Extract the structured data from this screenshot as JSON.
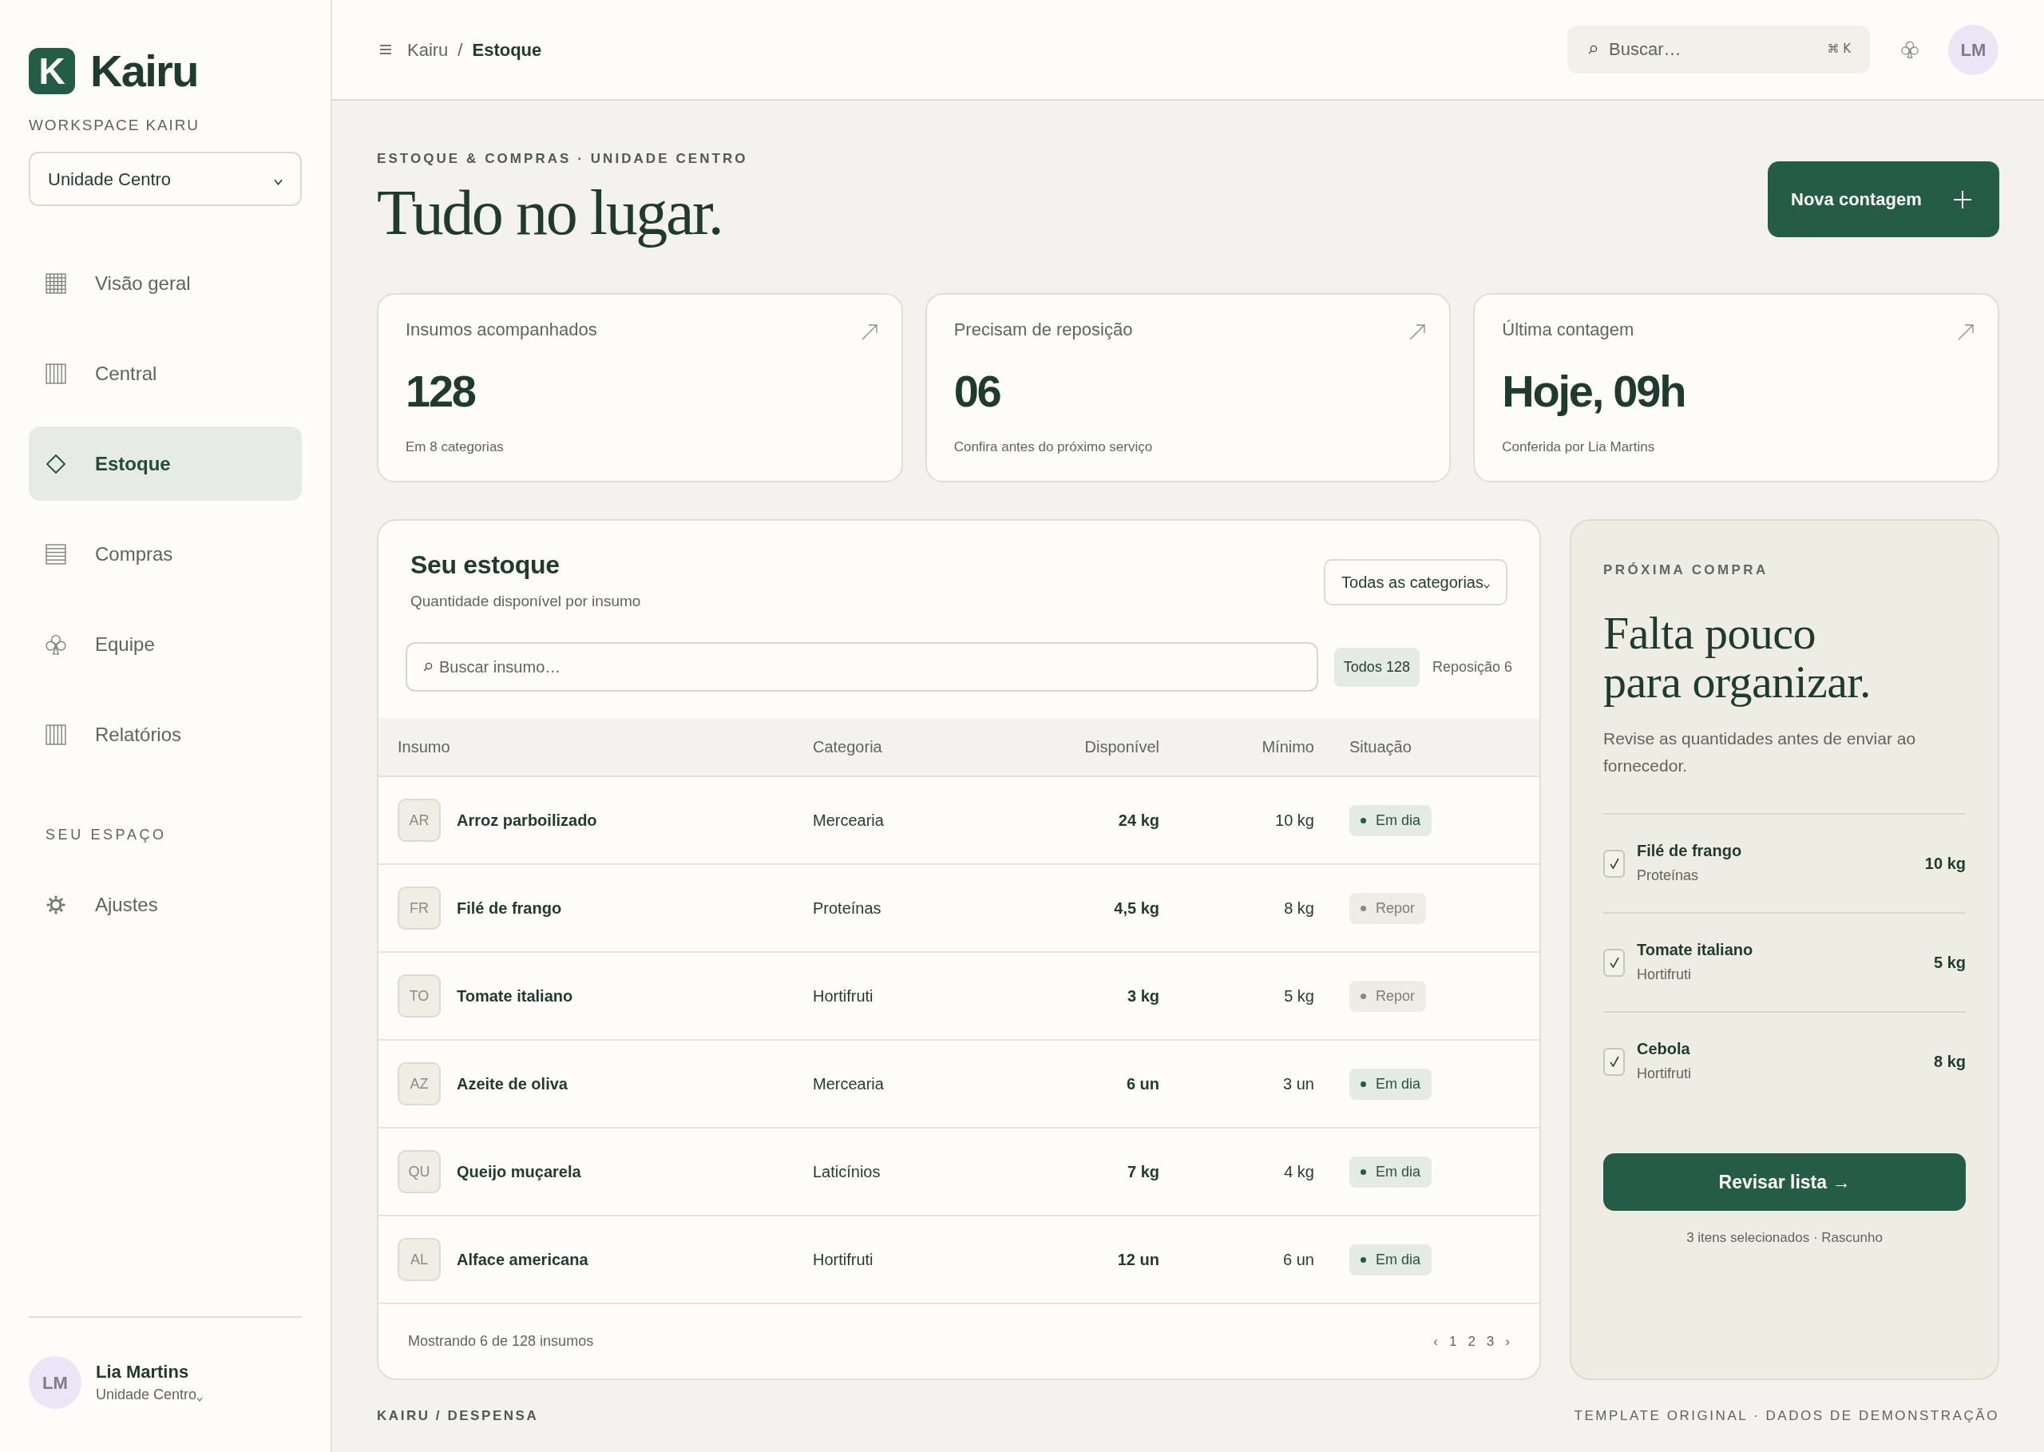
{
  "sidebar": {
    "brand": {
      "mark": "K",
      "name": "Kairu"
    },
    "workspace_label": "WORKSPACE KAIRU",
    "unit_select": {
      "value": "Unidade Centro"
    },
    "nav": [
      {
        "label": "Visão geral",
        "selected": false
      },
      {
        "label": "Central",
        "selected": false
      },
      {
        "label": "Estoque",
        "selected": true
      },
      {
        "label": "Compras",
        "selected": false
      },
      {
        "label": "Equipe",
        "selected": false
      },
      {
        "label": "Relatórios",
        "selected": false
      }
    ],
    "section_label": "SEU ESPAÇO",
    "settings_nav": [
      {
        "label": "Ajustes",
        "selected": false
      }
    ],
    "user": {
      "initials": "LM",
      "name": "Lia Martins",
      "unit": "Unidade Centro"
    }
  },
  "topbar": {
    "breadcrumb": [
      "Kairu",
      "Estoque"
    ],
    "separator": "/",
    "search": {
      "placeholder": "Buscar…",
      "shortcut": "⌘ K"
    },
    "avatar": "LM"
  },
  "header": {
    "eyebrow": "ESTOQUE & COMPRAS · UNIDADE CENTRO",
    "title": "Tudo no lugar.",
    "action": "Nova contagem"
  },
  "stats": [
    {
      "label": "Insumos acompanhados",
      "value": "128",
      "note": "Em 8 categorias"
    },
    {
      "label": "Precisam de reposição",
      "value": "06",
      "note": "Confira antes do próximo serviço"
    },
    {
      "label": "Última contagem",
      "value": "Hoje, 09h",
      "note": "Conferida por Lia Martins"
    }
  ],
  "inventory": {
    "title": "Seu estoque",
    "subtitle": "Quantidade disponível por insumo",
    "category_select": {
      "value": "Todas as categorias"
    },
    "search": {
      "placeholder": "Buscar insumo…"
    },
    "filters": [
      {
        "label": "Todos 128",
        "selected": true
      },
      {
        "label": "Reposição 6",
        "selected": false
      }
    ],
    "columns": [
      "Insumo",
      "Categoria",
      "Disponível",
      "Mínimo",
      "Situação"
    ],
    "rows": [
      {
        "initials": "AR",
        "name": "Arroz parboilizado",
        "category": "Mercearia",
        "available": "24 kg",
        "minimum": "10 kg",
        "status": {
          "label": "Em dia",
          "kind": "ok"
        }
      },
      {
        "initials": "FR",
        "name": "Filé de frango",
        "category": "Proteínas",
        "available": "4,5 kg",
        "minimum": "8 kg",
        "status": {
          "label": "Repor",
          "kind": "restock"
        }
      },
      {
        "initials": "TO",
        "name": "Tomate italiano",
        "category": "Hortifruti",
        "available": "3 kg",
        "minimum": "5 kg",
        "status": {
          "label": "Repor",
          "kind": "restock"
        }
      },
      {
        "initials": "AZ",
        "name": "Azeite de oliva",
        "category": "Mercearia",
        "available": "6 un",
        "minimum": "3 un",
        "status": {
          "label": "Em dia",
          "kind": "ok"
        }
      },
      {
        "initials": "QU",
        "name": "Queijo muçarela",
        "category": "Laticínios",
        "available": "7 kg",
        "minimum": "4 kg",
        "status": {
          "label": "Em dia",
          "kind": "ok"
        }
      },
      {
        "initials": "AL",
        "name": "Alface americana",
        "category": "Hortifruti",
        "available": "12 un",
        "minimum": "6 un",
        "status": {
          "label": "Em dia",
          "kind": "ok"
        }
      }
    ],
    "footer": "Mostrando 6 de 128 insumos",
    "pagination": {
      "prev": "‹",
      "pages": [
        "1",
        "2",
        "3"
      ],
      "next": "›"
    }
  },
  "next_purchase": {
    "eyebrow": "PRÓXIMA COMPRA",
    "title": "Falta pouco para organizar.",
    "description": "Revise as quantidades antes de enviar ao fornecedor.",
    "items": [
      {
        "name": "Filé de frango",
        "category": "Proteínas",
        "quantity": "10 kg",
        "checked": true
      },
      {
        "name": "Tomate italiano",
        "category": "Hortifruti",
        "quantity": "5 kg",
        "checked": true
      },
      {
        "name": "Cebola",
        "category": "Hortifruti",
        "quantity": "8 kg",
        "checked": true
      }
    ],
    "action": "Revisar lista →",
    "caption": "3 itens selecionados · Rascunho"
  },
  "footer": {
    "left": "KAIRU / DESPENSA",
    "right": "TEMPLATE ORIGINAL · DADOS DE DEMONSTRAÇÃO"
  }
}
